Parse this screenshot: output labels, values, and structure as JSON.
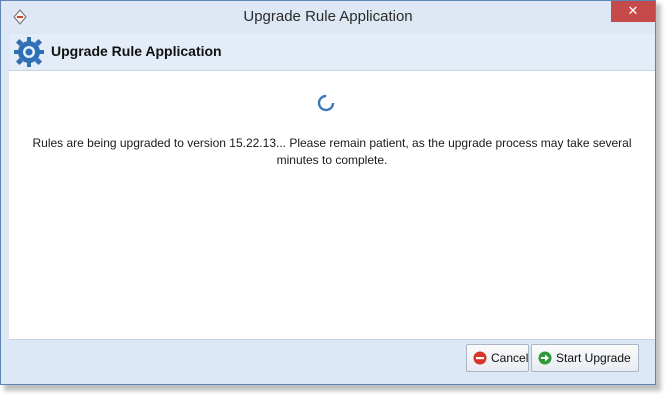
{
  "window": {
    "title": "Upgrade Rule Application",
    "close_glyph": "✕"
  },
  "header": {
    "title": "Upgrade Rule Application",
    "icon": "gear-icon"
  },
  "content": {
    "message_line1": "Rules are being upgraded to version 15.22.13... Please remain patient, as the upgrade process may take several",
    "message_line2": "minutes to complete.",
    "spinner": "loading-spinner-icon"
  },
  "footer": {
    "cancel_label": "Cancel",
    "start_label": "Start Upgrade"
  },
  "colors": {
    "accent": "#3a78b8",
    "close": "#c74a4a",
    "cancel_icon": "#d9342b",
    "start_icon": "#2e9a3a"
  }
}
